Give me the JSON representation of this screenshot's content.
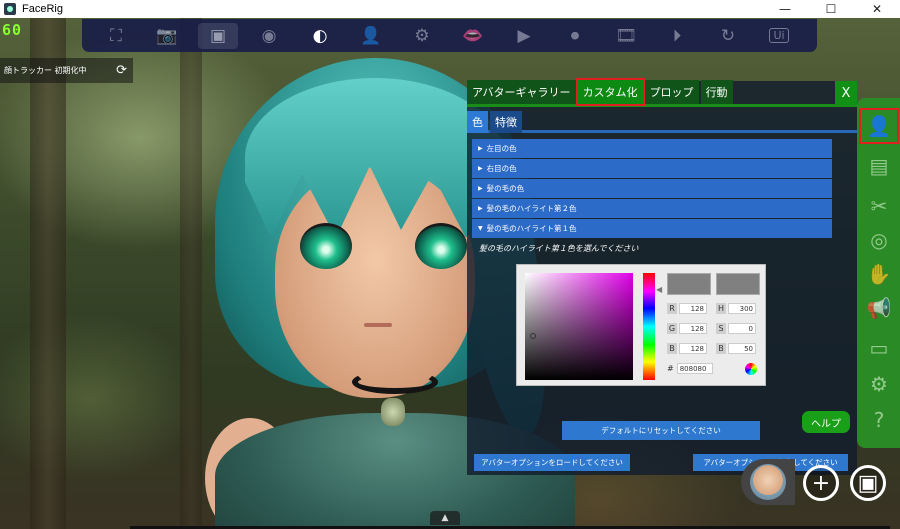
{
  "window": {
    "title": "FaceRig",
    "minimize": "—",
    "maximize": "☐",
    "close": "✕"
  },
  "fps": "60",
  "toolbar": {
    "ui_label": "Ui"
  },
  "tracker": {
    "status": "顔トラッカー 初期化中"
  },
  "panel": {
    "tabs": [
      "アバターギャラリー",
      "カスタム化",
      "プロップ",
      "行動"
    ],
    "close_label": "X",
    "subtabs": [
      "色",
      "特徴"
    ],
    "options": [
      {
        "arrow": "▶",
        "label": "左目の色"
      },
      {
        "arrow": "▶",
        "label": "右目の色"
      },
      {
        "arrow": "▶",
        "label": "髪の毛の色"
      },
      {
        "arrow": "▶",
        "label": "髪の毛のハイライト第２色"
      },
      {
        "arrow": "▼",
        "label": "髪の毛のハイライト第１色"
      }
    ],
    "prompt": "髪の毛のハイライト第１色を選んでください",
    "help_label": "ヘルプ",
    "reset_label": "デフォルトにリセットしてください",
    "load_label": "アバターオプションをロードしてください",
    "save_label": "アバターオプションを保存してください"
  },
  "picker": {
    "r": {
      "label": "R",
      "value": "128"
    },
    "g": {
      "label": "G",
      "value": "128"
    },
    "b": {
      "label": "B",
      "value": "128"
    },
    "h": {
      "label": "H",
      "value": "300"
    },
    "s": {
      "label": "S",
      "value": "0"
    },
    "v": {
      "label": "B",
      "value": "50"
    },
    "hex_label": "#",
    "hex_value": "808080",
    "current_color": "#808080"
  },
  "colors": {
    "accent_green": "#1a8c18",
    "accent_blue": "#2e79cf",
    "highlight_red": "#e02020"
  }
}
